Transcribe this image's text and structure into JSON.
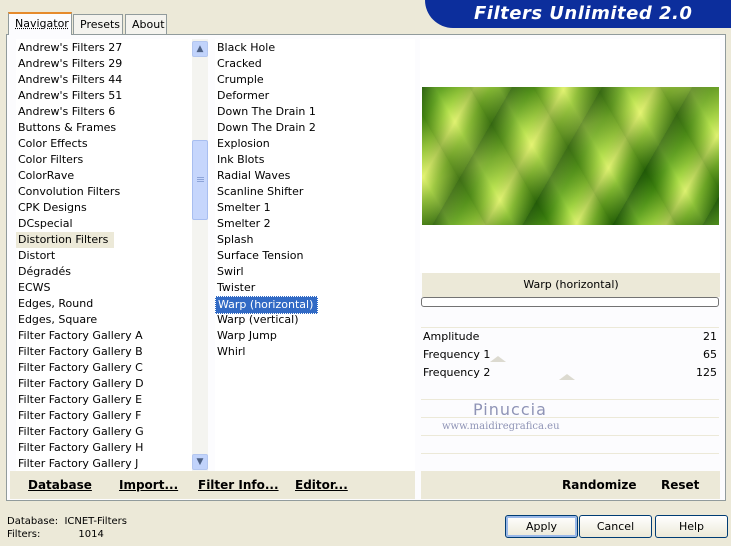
{
  "tabs": [
    "Navigator",
    "Presets",
    "About"
  ],
  "app_title": "Filters Unlimited 2.0",
  "categories": [
    "Andrew's Filters 27",
    "Andrew's Filters 29",
    "Andrew's Filters 44",
    "Andrew's Filters 51",
    "Andrew's Filters 6",
    "Buttons & Frames",
    "Color Effects",
    "Color Filters",
    "ColorRave",
    "Convolution Filters",
    "CPK Designs",
    "DCspecial",
    "Distortion Filters",
    "Distort",
    "Dégradés",
    "ECWS",
    "Edges, Round",
    "Edges, Square",
    "Filter Factory Gallery A",
    "Filter Factory Gallery B",
    "Filter Factory Gallery C",
    "Filter Factory Gallery D",
    "Filter Factory Gallery E",
    "Filter Factory Gallery F",
    "Filter Factory Gallery G",
    "Filter Factory Gallery H",
    "Filter Factory Gallery J"
  ],
  "selected_category": "Distortion Filters",
  "filters": [
    "Black Hole",
    "Cracked",
    "Crumple",
    "Deformer",
    "Down The Drain 1",
    "Down The Drain 2",
    "Explosion",
    "Ink Blots",
    "Radial Waves",
    "Scanline Shifter",
    "Smelter 1",
    "Smelter 2",
    "Splash",
    "Surface Tension",
    "Swirl",
    "Twister",
    "Warp (horizontal)",
    "Warp (vertical)",
    "Warp Jump",
    "Whirl"
  ],
  "selected_filter": "Warp (horizontal)",
  "filter_title": "Warp (horizontal)",
  "params": [
    {
      "label": "Amplitude",
      "value": "21"
    },
    {
      "label": "Frequency 1",
      "value": "65"
    },
    {
      "label": "Frequency 2",
      "value": "125"
    }
  ],
  "watermark": {
    "line1": "Pinuccia",
    "line2": "www.maidiregrafica.eu"
  },
  "bottom_buttons": {
    "database": "Database",
    "import": "Import...",
    "filter_info": "Filter Info...",
    "editor": "Editor...",
    "randomize": "Randomize",
    "reset": "Reset"
  },
  "status": {
    "database_label": "Database:",
    "database_value": "ICNET-Filters",
    "filters_label": "Filters:",
    "filters_value": "1014"
  },
  "dialog_buttons": {
    "apply": "Apply",
    "cancel": "Cancel",
    "help": "Help"
  }
}
